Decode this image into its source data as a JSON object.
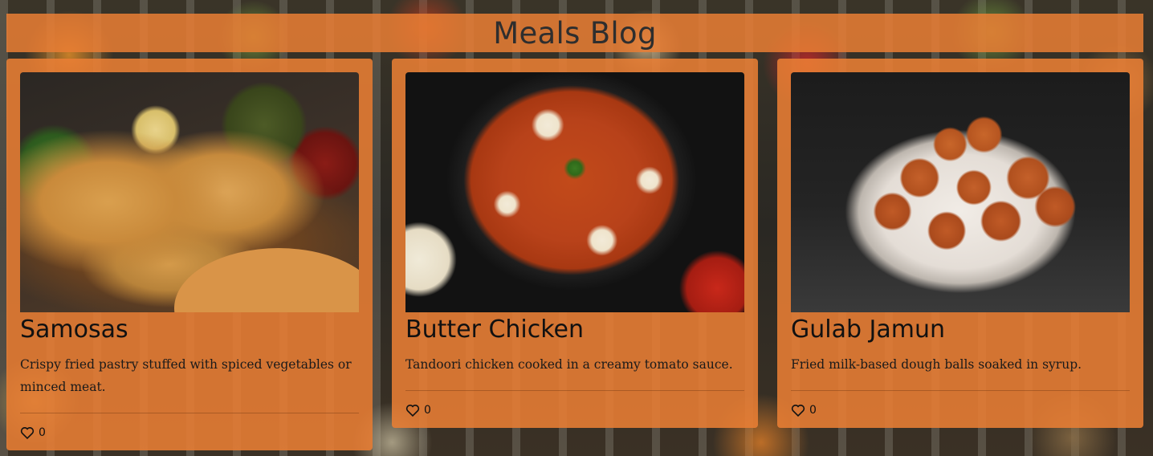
{
  "header": {
    "title": "Meals Blog"
  },
  "meals": [
    {
      "title": "Samosas",
      "description": "Crispy fried pastry stuffed with spiced vegetables or minced meat.",
      "likes": "0"
    },
    {
      "title": "Butter Chicken",
      "description": "Tandoori chicken cooked in a creamy tomato sauce.",
      "likes": "0"
    },
    {
      "title": "Gulab Jamun",
      "description": "Fried milk-based dough balls soaked in syrup.",
      "likes": "0"
    }
  ],
  "icons": {
    "like": "heart-icon"
  },
  "colors": {
    "accent": "#E97E34",
    "text": "#111111"
  }
}
